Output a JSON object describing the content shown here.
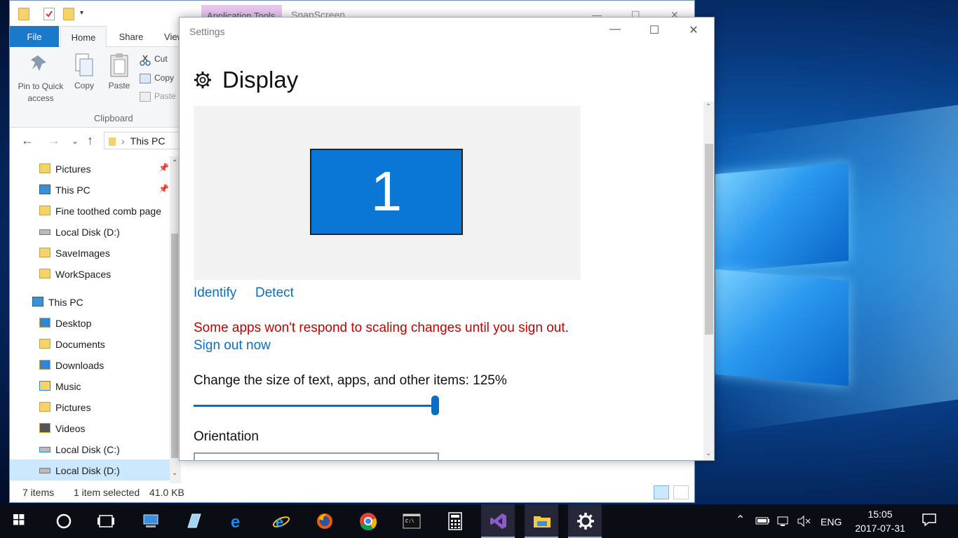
{
  "explorer": {
    "app_tools_label": "Application Tools",
    "window_title": "SnapScreen",
    "tabs": [
      "File",
      "Home",
      "Share",
      "View"
    ],
    "ribbon": {
      "pin_label": "Pin to Quick access",
      "copy_label": "Copy",
      "paste_label": "Paste",
      "cut_label": "Cut",
      "copy_path_label": "Copy",
      "paste_shortcut_label": "Paste",
      "group_label": "Clipboard"
    },
    "address": "This PC",
    "nav_items": [
      {
        "label": "Pictures",
        "icon": "pictures-folder-icon",
        "pinned": true
      },
      {
        "label": "This PC",
        "icon": "computer-icon",
        "pinned": true
      },
      {
        "label": "Fine toothed comb page",
        "icon": "folder-icon",
        "pinned": false
      },
      {
        "label": "Local Disk (D:)",
        "icon": "drive-icon",
        "pinned": false
      },
      {
        "label": "SaveImages",
        "icon": "folder-icon",
        "pinned": false
      },
      {
        "label": "WorkSpaces",
        "icon": "folder-icon",
        "pinned": false
      },
      {
        "label": "This PC",
        "icon": "computer-icon",
        "pinned": false
      },
      {
        "label": "Desktop",
        "icon": "desktop-folder-icon",
        "pinned": false
      },
      {
        "label": "Documents",
        "icon": "documents-folder-icon",
        "pinned": false
      },
      {
        "label": "Downloads",
        "icon": "downloads-folder-icon",
        "pinned": false
      },
      {
        "label": "Music",
        "icon": "music-folder-icon",
        "pinned": false
      },
      {
        "label": "Pictures",
        "icon": "pictures-folder-icon",
        "pinned": false
      },
      {
        "label": "Videos",
        "icon": "videos-folder-icon",
        "pinned": false
      },
      {
        "label": "Local Disk (C:)",
        "icon": "windows-drive-icon",
        "pinned": false
      },
      {
        "label": "Local Disk (D:)",
        "icon": "drive-icon",
        "pinned": false,
        "selected": true
      }
    ],
    "status": {
      "items": "7 items",
      "selection": "1 item selected",
      "size": "41.0 KB"
    }
  },
  "settings": {
    "window_title": "Settings",
    "page_title": "Display",
    "monitor_number": "1",
    "identify_label": "Identify",
    "detect_label": "Detect",
    "warning_text": "Some apps won't respond to scaling changes until you sign out.",
    "sign_out_label": "Sign out now",
    "scale_label": "Change the size of text, apps, and other items: 125%",
    "scale_value_percent": 125,
    "orientation_label": "Orientation"
  },
  "taskbar": {
    "apps": [
      "start-icon",
      "cortana-icon",
      "task-view-icon",
      "computer-app-icon",
      "notepad-icon",
      "edge-icon",
      "internet-explorer-icon",
      "firefox-icon",
      "chrome-icon",
      "cmd-icon",
      "calculator-icon",
      "visual-studio-icon",
      "file-explorer-icon",
      "settings-gear-icon"
    ],
    "language": "ENG",
    "time": "15:05",
    "date": "2017-07-31"
  },
  "colors": {
    "accent": "#0a6ec4",
    "warning": "#c40000",
    "monitor": "#0a76d6",
    "file_tab": "#1979ca"
  }
}
